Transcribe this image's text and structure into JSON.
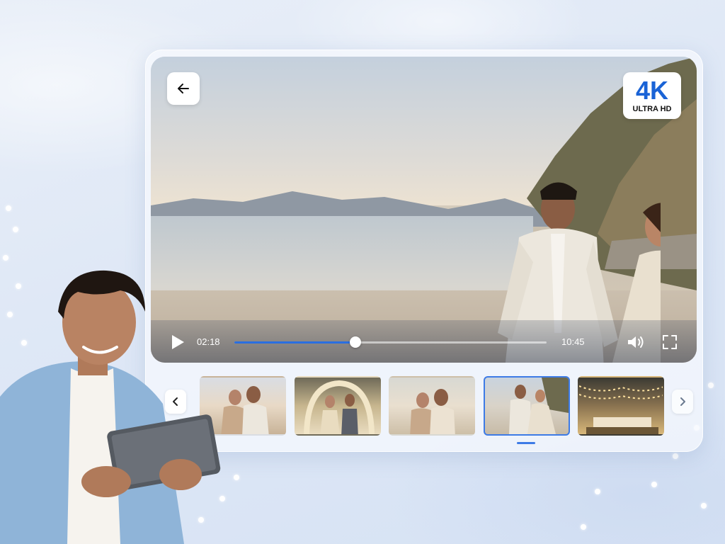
{
  "player": {
    "back_icon": "arrow-left-icon",
    "quality_badge": {
      "main": "4K",
      "sub": "ULTRA HD",
      "color": "#1a63d6"
    },
    "current_time": "02:18",
    "total_time": "10:45",
    "progress_fraction": 0.39,
    "accent_color": "#2a6ee0",
    "play_icon": "play-icon",
    "volume_icon": "volume-icon",
    "fullscreen_icon": "fullscreen-icon"
  },
  "carousel": {
    "prev_icon": "chevron-left-icon",
    "next_icon": "chevron-right-icon",
    "selected_index": 3,
    "thumbnails": [
      {
        "label": "couple-embrace-sunset"
      },
      {
        "label": "floral-arch-ceremony"
      },
      {
        "label": "couple-hug-flowers"
      },
      {
        "label": "beach-walk"
      },
      {
        "label": "reception-lights"
      }
    ]
  }
}
